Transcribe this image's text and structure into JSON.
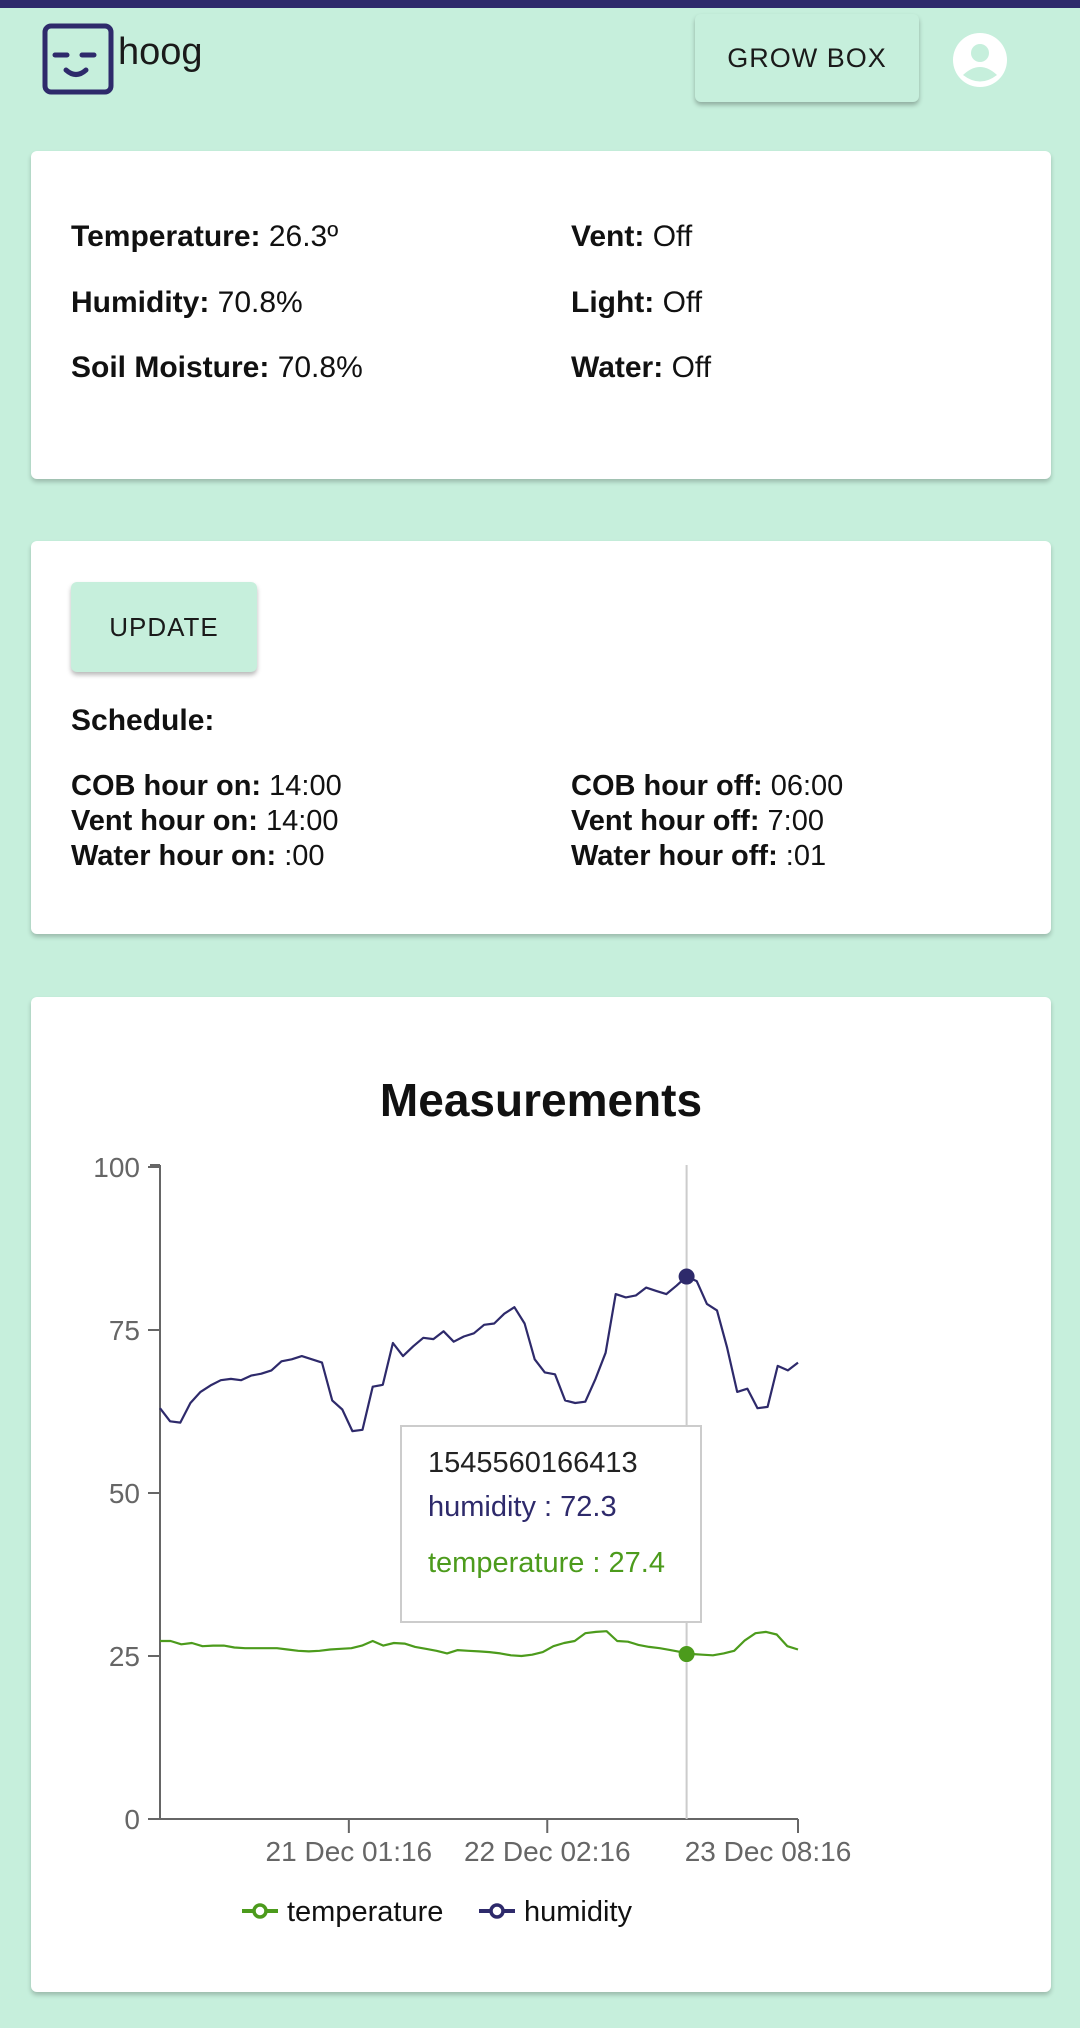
{
  "app": {
    "name": "hoog"
  },
  "header": {
    "grow_box_label": "GROW BOX"
  },
  "colors": {
    "accent": "#c6efdc",
    "topbar": "#2e2a6b",
    "temperature": "#4c9b1c",
    "humidity": "#2e2a6b"
  },
  "status": {
    "temperature": {
      "label": "Temperature:",
      "value": "26.3º"
    },
    "humidity": {
      "label": "Humidity:",
      "value": "70.8%"
    },
    "soil_moisture": {
      "label": "Soil Moisture:",
      "value": "70.8%"
    },
    "vent": {
      "label": "Vent:",
      "value": "Off"
    },
    "light": {
      "label": "Light:",
      "value": "Off"
    },
    "water": {
      "label": "Water:",
      "value": "Off"
    }
  },
  "schedule": {
    "update_label": "UPDATE",
    "title": "Schedule:",
    "cob_on": {
      "label": "COB hour on:",
      "value": "14:00"
    },
    "vent_on": {
      "label": "Vent hour on:",
      "value": "14:00"
    },
    "water_on": {
      "label": "Water hour on:",
      "value": ":00"
    },
    "cob_off": {
      "label": "COB hour off:",
      "value": "06:00"
    },
    "vent_off": {
      "label": "Vent hour off:",
      "value": "7:00"
    },
    "water_off": {
      "label": "Water hour off:",
      "value": ":01"
    }
  },
  "tooltip": {
    "timestamp": "1545560166413",
    "humidity_text": "humidity : 72.3",
    "temperature_text": "temperature : 27.4"
  },
  "chart_data": {
    "type": "line",
    "title": "Measurements",
    "xlabel": "",
    "ylabel": "",
    "ylim": [
      0,
      100
    ],
    "yticks": [
      "0",
      "25",
      "50",
      "75",
      "100"
    ],
    "xticks": [
      "21 Dec 01:16",
      "22 Dec 02:16",
      "23 Dec 08:16"
    ],
    "xtick_positions": [
      0.296,
      0.607,
      1.0
    ],
    "hover_index": 52,
    "legend_position": "bottom",
    "series": [
      {
        "name": "temperature",
        "color": "#4c9b1c",
        "values": [
          27.3,
          27.3,
          26.8,
          27.0,
          26.5,
          26.6,
          26.6,
          26.3,
          26.2,
          26.2,
          26.2,
          26.2,
          26.0,
          25.8,
          25.7,
          25.8,
          26.0,
          26.1,
          26.2,
          26.6,
          27.3,
          26.6,
          27.0,
          26.9,
          26.4,
          26.1,
          25.8,
          25.4,
          25.9,
          25.8,
          25.7,
          25.6,
          25.4,
          25.1,
          25.0,
          25.2,
          25.6,
          26.5,
          27.0,
          27.3,
          28.5,
          28.7,
          28.8,
          27.3,
          27.2,
          26.7,
          26.4,
          26.2,
          25.9,
          25.6,
          25.3,
          25.2,
          25.1,
          25.4,
          25.8,
          27.4,
          28.5,
          28.7,
          28.3,
          26.5,
          26.0
        ]
      },
      {
        "name": "humidity",
        "color": "#2e2a6b",
        "values": [
          63.0,
          61.0,
          60.8,
          63.8,
          65.5,
          66.5,
          67.3,
          67.5,
          67.3,
          68.0,
          68.3,
          68.8,
          70.2,
          70.5,
          71.0,
          70.5,
          70.0,
          64.2,
          62.8,
          59.5,
          59.7,
          66.3,
          66.6,
          73.0,
          71.0,
          72.5,
          73.8,
          73.6,
          74.8,
          73.2,
          74.0,
          74.5,
          75.8,
          76.0,
          77.5,
          78.5,
          76.0,
          70.5,
          68.5,
          68.2,
          64.2,
          63.8,
          64.0,
          67.5,
          71.5,
          80.5,
          80.0,
          80.3,
          81.5,
          81.0,
          80.5,
          81.8,
          83.2,
          82.5,
          79.0,
          78.0,
          72.3,
          65.5,
          66.0,
          63.0,
          63.2,
          69.5,
          68.8,
          70.0
        ]
      }
    ]
  }
}
